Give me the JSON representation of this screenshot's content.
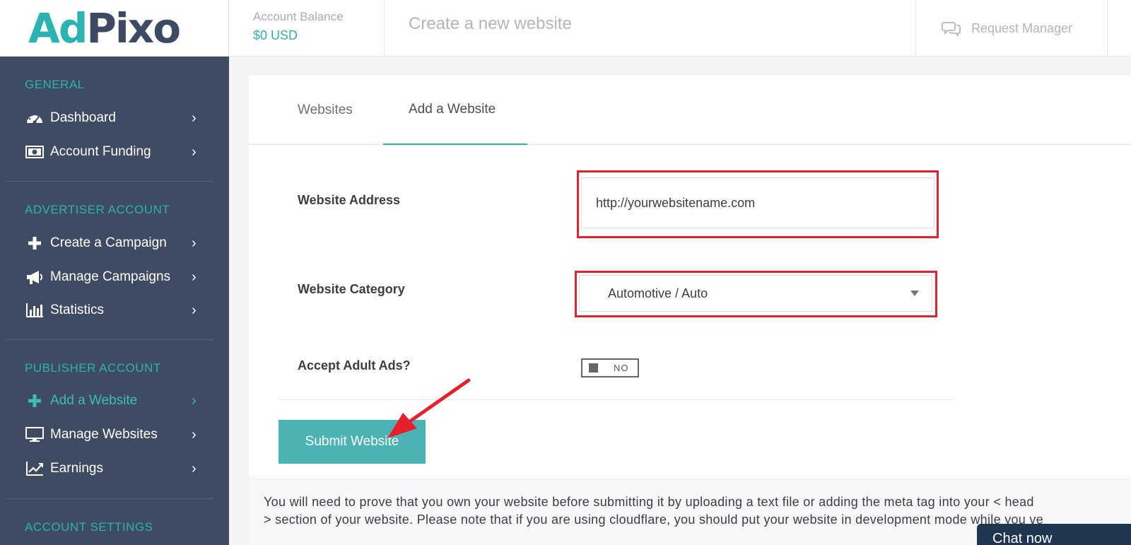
{
  "logo": {
    "part1": "Ad",
    "part2": "Pixo"
  },
  "header": {
    "balance_label": "Account Balance",
    "balance_value": "$0 USD",
    "page_title": "Create a new website",
    "request_manager": "Request Manager"
  },
  "sidebar": {
    "general_title": "GENERAL",
    "general_items": [
      {
        "label": "Dashboard",
        "icon": "dashboard-icon"
      },
      {
        "label": "Account Funding",
        "icon": "money-icon"
      }
    ],
    "advertiser_title": "ADVERTISER ACCOUNT",
    "advertiser_items": [
      {
        "label": "Create a Campaign",
        "icon": "plus-icon"
      },
      {
        "label": "Manage Campaigns",
        "icon": "megaphone-icon"
      },
      {
        "label": "Statistics",
        "icon": "bar-chart-icon"
      }
    ],
    "publisher_title": "PUBLISHER ACCOUNT",
    "publisher_items": [
      {
        "label": "Add a Website",
        "icon": "plus-icon",
        "active": true
      },
      {
        "label": "Manage Websites",
        "icon": "monitor-icon"
      },
      {
        "label": "Earnings",
        "icon": "line-chart-icon"
      }
    ],
    "settings_title": "ACCOUNT SETTINGS"
  },
  "tabs": [
    {
      "label": "Websites",
      "active": false
    },
    {
      "label": "Add a Website",
      "active": true
    }
  ],
  "form": {
    "website_address_label": "Website Address",
    "website_address_value": "http://yourwebsitename.com",
    "website_category_label": "Website Category",
    "website_category_value": "Automotive / Auto",
    "adult_ads_label": "Accept Adult Ads?",
    "adult_ads_toggle": "NO",
    "submit_label": "Submit Website"
  },
  "note": {
    "line1": "You will need to prove that you own your website before submitting it by uploading a text file or adding the meta tag into your < head",
    "line2": "> section of your website. Please note that if you are using cloudflare, you should put your website in development mode while you ve"
  },
  "chat": {
    "label": "Chat now"
  },
  "colors": {
    "accent": "#2ab3b1",
    "sidebar_bg": "#3f4b62",
    "highlight_red": "#e8202b",
    "button": "#4bb3b3"
  }
}
